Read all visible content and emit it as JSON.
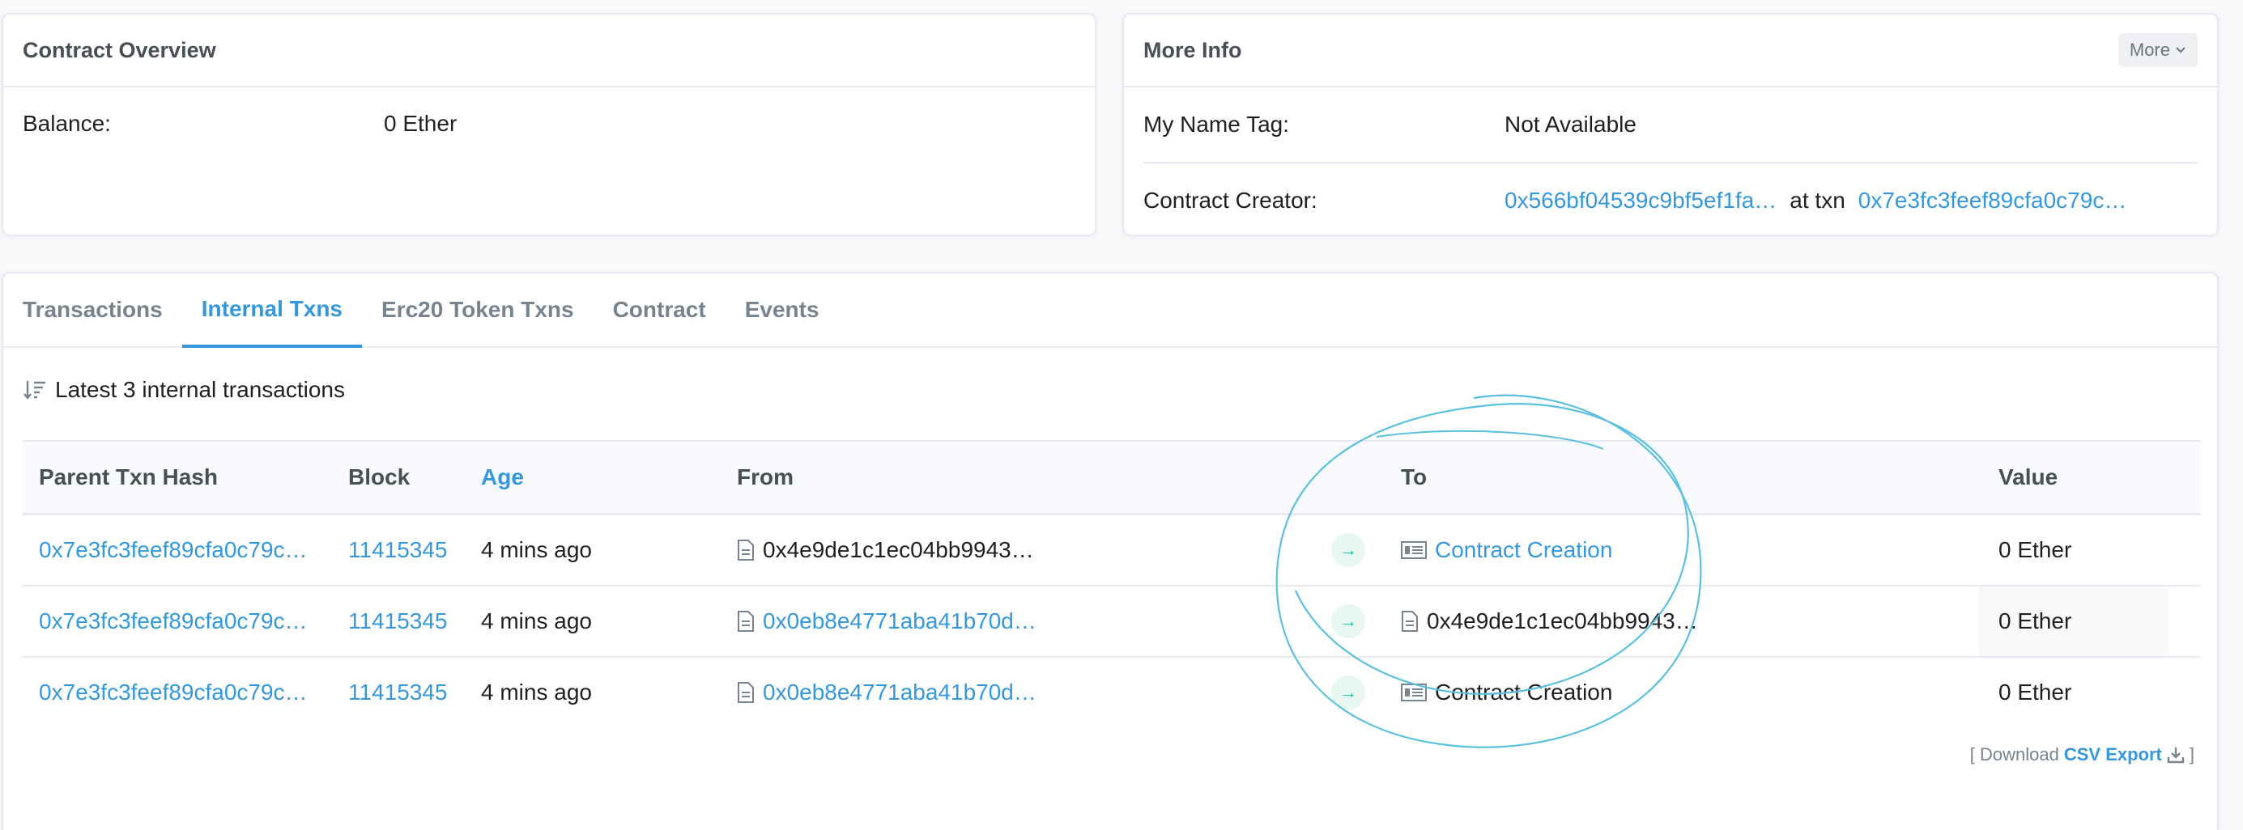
{
  "overview": {
    "title": "Contract Overview",
    "balance_label": "Balance:",
    "balance_value": "0 Ether"
  },
  "more_info": {
    "title": "More Info",
    "more_button": "More",
    "name_tag_label": "My Name Tag:",
    "name_tag_value": "Not Available",
    "creator_label": "Contract Creator:",
    "creator_address": "0x566bf04539c9bf5ef1fa…",
    "at_txn": "at txn",
    "creator_txn": "0x7e3fc3feef89cfa0c79c…"
  },
  "tabs": [
    {
      "label": "Transactions",
      "active": false
    },
    {
      "label": "Internal Txns",
      "active": true
    },
    {
      "label": "Erc20 Token Txns",
      "active": false
    },
    {
      "label": "Contract",
      "active": false
    },
    {
      "label": "Events",
      "active": false
    }
  ],
  "summary": "Latest 3 internal transactions",
  "table": {
    "headers": {
      "hash": "Parent Txn Hash",
      "block": "Block",
      "age": "Age",
      "from": "From",
      "to": "To",
      "value": "Value"
    },
    "rows": [
      {
        "hash": "0x7e3fc3feef89cfa0c79c…",
        "block": "11415345",
        "age": "4 mins ago",
        "from": "0x4e9de1c1ec04bb9943…",
        "to": "Contract Creation",
        "value": "0 Ether"
      },
      {
        "hash": "0x7e3fc3feef89cfa0c79c…",
        "block": "11415345",
        "age": "4 mins ago",
        "from": "0x0eb8e4771aba41b70d…",
        "to": "0x4e9de1c1ec04bb9943…",
        "value": "0 Ether"
      },
      {
        "hash": "0x7e3fc3feef89cfa0c79c…",
        "block": "11415345",
        "age": "4 mins ago",
        "from": "0x0eb8e4771aba41b70d…",
        "to": "Contract Creation",
        "value": "0 Ether"
      }
    ]
  },
  "download": {
    "prefix": "[ Download",
    "link": "CSV Export",
    "suffix": "]"
  },
  "colors": {
    "link": "#3498db",
    "arrow": "#00c9a7",
    "annotation": "#5bc0de"
  }
}
